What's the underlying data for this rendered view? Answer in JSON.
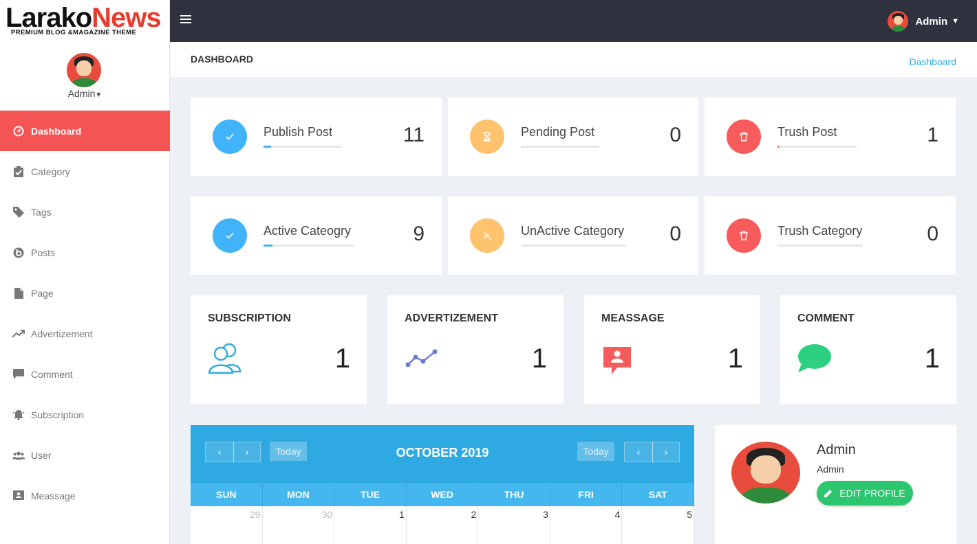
{
  "brand": {
    "part1": "Larako",
    "part2": "News",
    "tagline": "PREMIUM BLOG &MAGAZINE THEME"
  },
  "topbar": {
    "user_name": "Admin"
  },
  "sidebar": {
    "user_name": "Admin",
    "items": [
      {
        "label": "Dashboard",
        "icon": "dashboard-icon",
        "active": true
      },
      {
        "label": "Category",
        "icon": "clipboard-check-icon"
      },
      {
        "label": "Tags",
        "icon": "tag-icon"
      },
      {
        "label": "Posts",
        "icon": "bold-circle-icon"
      },
      {
        "label": "Page",
        "icon": "file-icon"
      },
      {
        "label": "Advertizement",
        "icon": "trend-icon"
      },
      {
        "label": "Comment",
        "icon": "comment-icon"
      },
      {
        "label": "Subscription",
        "icon": "bell-icon"
      },
      {
        "label": "User",
        "icon": "users-icon"
      },
      {
        "label": "Meassage",
        "icon": "contact-icon"
      }
    ]
  },
  "header": {
    "title": "DASHBOARD",
    "breadcrumb": "Dashboard"
  },
  "stats": [
    {
      "label": "Publish Post",
      "value": "11",
      "icon": "check-icon",
      "color": "#41b3f9",
      "progress": 0.1
    },
    {
      "label": "Pending Post",
      "value": "0",
      "icon": "hourglass-icon",
      "color": "#ffc36d",
      "progress": 0
    },
    {
      "label": "Trush Post",
      "value": "1",
      "icon": "trash-icon",
      "color": "#f75b5b",
      "progress": 0.02
    },
    {
      "label": "Active Cateogry",
      "value": "9",
      "icon": "check-icon",
      "color": "#41b3f9",
      "progress": 0.1
    },
    {
      "label": "UnActive Category",
      "value": "0",
      "icon": "disabled-icon",
      "color": "#ffc36d",
      "progress": 0
    },
    {
      "label": "Trush Category",
      "value": "0",
      "icon": "trash-icon",
      "color": "#f75b5b",
      "progress": 0
    }
  ],
  "boxes": [
    {
      "title": "SUBSCRIPTION",
      "value": "1",
      "icon": "users-outline-icon",
      "color": "#2fa9e2"
    },
    {
      "title": "ADVERTIZEMENT",
      "value": "1",
      "icon": "line-trend-icon",
      "color": "#707cd2"
    },
    {
      "title": "MEASSAGE",
      "value": "1",
      "icon": "message-alert-icon",
      "color": "#f75b5b"
    },
    {
      "title": "COMMENT",
      "value": "1",
      "icon": "speech-bubble-icon",
      "color": "#2cd07e"
    }
  ],
  "calendar": {
    "title": "OCTOBER 2019",
    "today": "Today",
    "prev": "‹",
    "next": "›",
    "weekdays": [
      "SUN",
      "MON",
      "TUE",
      "WED",
      "THU",
      "FRI",
      "SAT"
    ],
    "first_row": [
      "29",
      "30",
      "1",
      "2",
      "3",
      "4",
      "5"
    ]
  },
  "profile": {
    "name": "Admin",
    "role": "Admin",
    "button": "EDIT PROFILE"
  }
}
